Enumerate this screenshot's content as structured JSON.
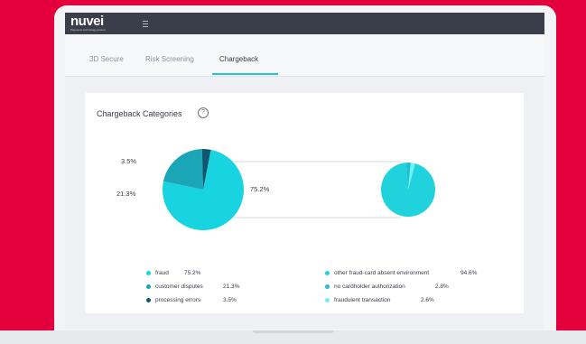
{
  "header": {
    "logo_text": "nuvei",
    "logo_subtext": "Payments technology partner",
    "menu_icon": "hamburger-icon"
  },
  "tabs": [
    {
      "label": "3D Secure",
      "active": false
    },
    {
      "label": "Risk Screening",
      "active": false
    },
    {
      "label": "Chargeback",
      "active": true
    }
  ],
  "card": {
    "title": "Chargeback Categories",
    "help_icon": "question-circle-icon",
    "help_glyph": "?"
  },
  "colors": {
    "brand_background": "#e4003c",
    "accent": "#21c6c6",
    "fraud": "#17d4e0",
    "customer_disputes": "#1aa6b7",
    "processing_errors": "#0e5770",
    "other_fraud": "#20d2dc",
    "no_cardholder": "#1ebfd0",
    "fraudulent_transaction": "#6ff2f6"
  },
  "chart_data": {
    "type": "pie",
    "main_pie": {
      "labels": [
        "fraud",
        "customer disputes",
        "processing errors"
      ],
      "values": [
        75.2,
        21.3,
        3.5
      ],
      "value_labels": [
        "75.2%",
        "21.3%",
        "3.5%"
      ],
      "colors": [
        "#17d4e0",
        "#1aa6b7",
        "#0e5770"
      ]
    },
    "secondary_pie": {
      "labels": [
        "other fraud-card absent environment",
        "no cardholder authorization",
        "fraudulent transaction"
      ],
      "values": [
        94.6,
        2.8,
        2.6
      ],
      "colors": [
        "#20d2dc",
        "#1ebfd0",
        "#6ff2f6"
      ]
    },
    "legend_left": [
      {
        "name": "fraud",
        "value": "75.2%"
      },
      {
        "name": "customer disputes",
        "value": "21.3%"
      },
      {
        "name": "processing errors",
        "value": "3.5%"
      }
    ],
    "legend_right": [
      {
        "name": "other fraud-card absent environment",
        "value": "94.6%"
      },
      {
        "name": "no cardholder authorization",
        "value": "2.8%"
      },
      {
        "name": "fraudulent transaction",
        "value": "2.6%"
      }
    ]
  }
}
